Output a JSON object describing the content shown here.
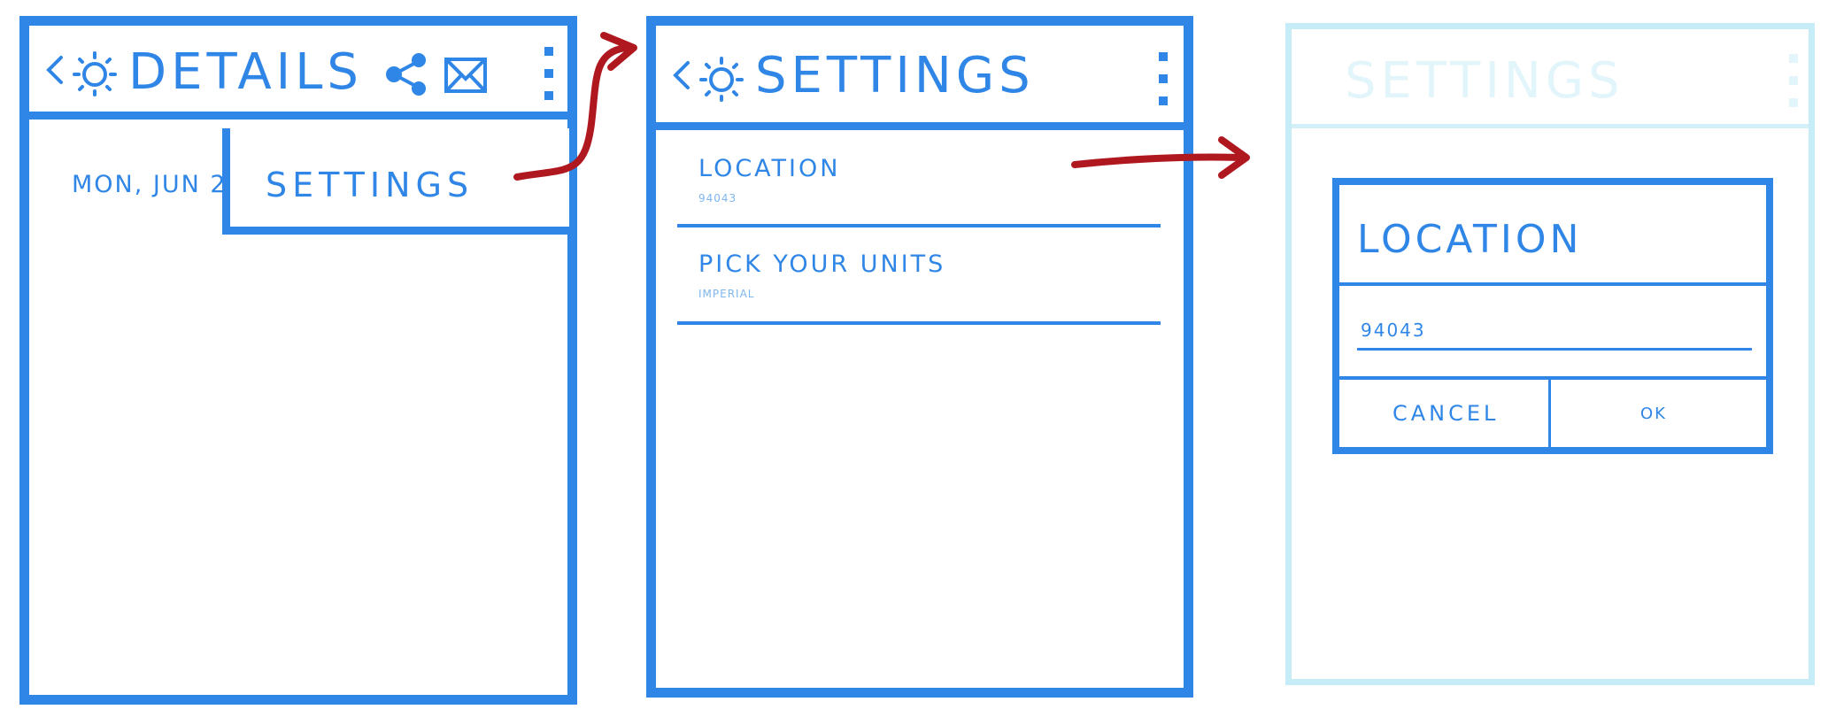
{
  "colors": {
    "ink": "#2f86e6",
    "faded": "#c6ecf7",
    "arrow": "#b01820"
  },
  "screen1": {
    "title": "DETAILS",
    "date_text": "MON, JUN 2",
    "menu_item": "SETTINGS",
    "icons": [
      "back-icon",
      "sun-icon",
      "share-icon",
      "mail-icon",
      "overflow-icon"
    ]
  },
  "screen2": {
    "title": "SETTINGS",
    "items": [
      {
        "label": "LOCATION",
        "value": "94043"
      },
      {
        "label": "PICK YOUR UNITS",
        "value": "IMPERIAL"
      }
    ]
  },
  "screen3": {
    "faded_title": "SETTINGS",
    "dialog": {
      "title": "LOCATION",
      "input_value": "94043",
      "cancel_label": "CANCEL",
      "ok_label": "OK"
    }
  }
}
